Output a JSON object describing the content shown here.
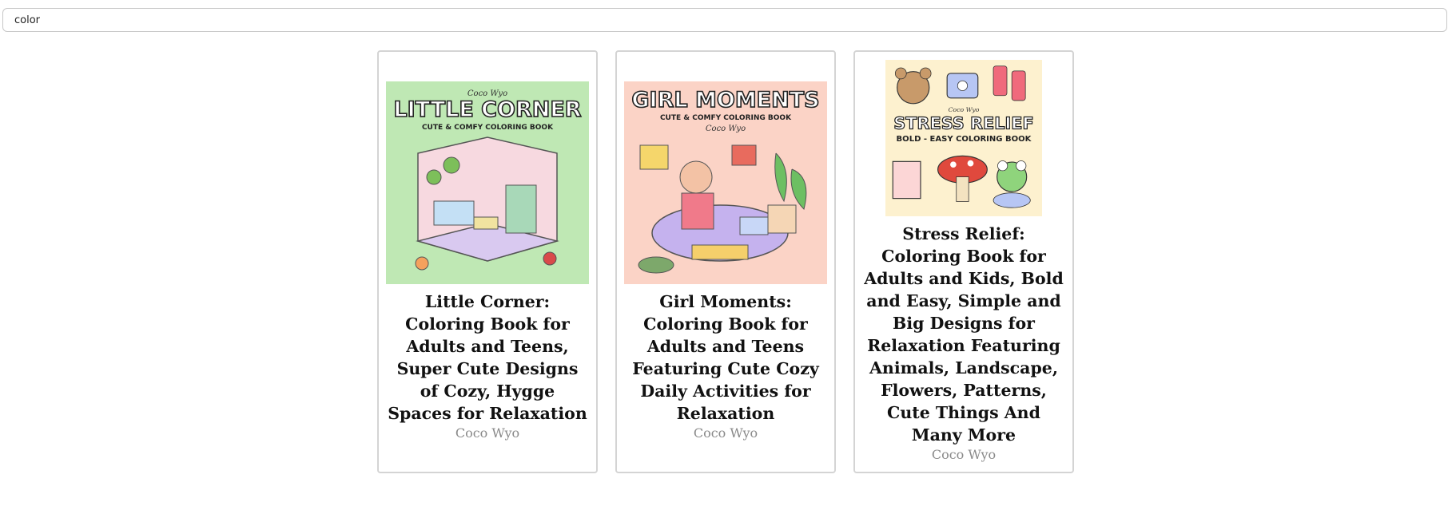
{
  "search": {
    "value": "color",
    "placeholder": ""
  },
  "results": [
    {
      "title": "Little Corner: Coloring Book for Adults and Teens, Super Cute Designs of Cozy, Hygge Spaces for Relaxation",
      "author": "Coco Wyo",
      "cover": {
        "brand": "Coco Wyo",
        "headline": "LITTLE CORNER",
        "tagline": "CUTE & COMFY COLORING BOOK",
        "background": "#bfe8b4"
      }
    },
    {
      "title": "Girl Moments: Coloring Book for Adults and Teens Featuring Cute Cozy Daily Activities for Relaxation",
      "author": "Coco Wyo",
      "cover": {
        "brand": "Coco Wyo",
        "headline": "GIRL MOMENTS",
        "tagline": "CUTE & COMFY COLORING BOOK",
        "background": "#fbd3c6"
      }
    },
    {
      "title": "Stress Relief: Coloring Book for Adults and Kids, Bold and Easy, Simple and Big Designs for Relaxation Featuring Animals, Landscape, Flowers, Patterns, Cute Things And Many More",
      "author": "Coco Wyo",
      "cover": {
        "brand": "Coco Wyo",
        "headline": "STRESS RELIEF",
        "tagline": "BOLD - EASY COLORING BOOK",
        "background": "#fdf1cf"
      }
    }
  ]
}
